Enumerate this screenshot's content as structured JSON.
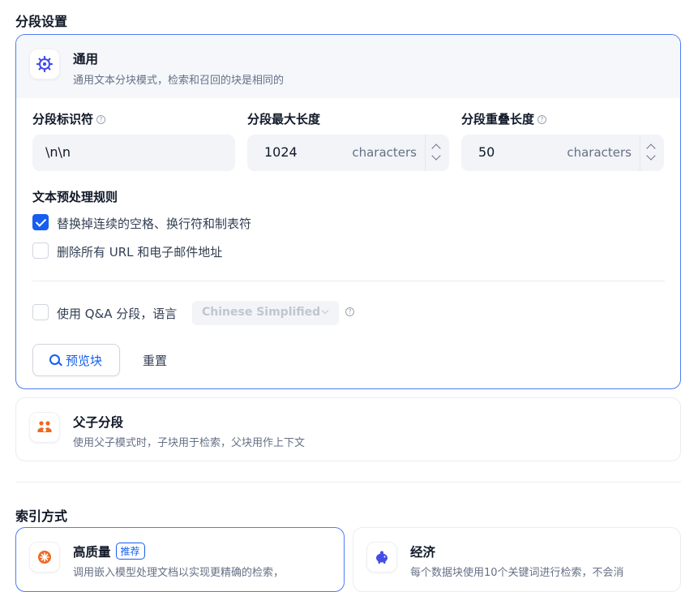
{
  "segment_settings": {
    "title": "分段设置",
    "general": {
      "title": "通用",
      "description": "通用文本分块模式，检索和召回的块是相同的",
      "delimiter": {
        "label": "分段标识符",
        "value": "\\n\\n"
      },
      "max_length": {
        "label": "分段最大长度",
        "value": "1024",
        "unit": "characters"
      },
      "overlap": {
        "label": "分段重叠长度",
        "value": "50",
        "unit": "characters"
      },
      "preprocess": {
        "title": "文本预处理规则",
        "rule_spaces": {
          "label": "替换掉连续的空格、换行符和制表符",
          "checked": true
        },
        "rule_urls": {
          "label": "删除所有 URL 和电子邮件地址",
          "checked": false
        }
      },
      "qa": {
        "label": "使用 Q&A 分段，语言",
        "language": "Chinese Simplified",
        "checked": false
      },
      "preview_button": "预览块",
      "reset_button": "重置"
    },
    "parent_child": {
      "title": "父子分段",
      "description": "使用父子模式时，子块用于检索，父块用作上下文"
    }
  },
  "index_mode": {
    "title": "索引方式",
    "high_quality": {
      "title": "高质量",
      "badge": "推荐",
      "description": "调用嵌入模型处理文档以实现更精确的检索，"
    },
    "economy": {
      "title": "经济",
      "description": "每个数据块使用10个关键词进行检索，不会消"
    }
  },
  "colors": {
    "accent": "#155eef",
    "border_active": "#4d7df2",
    "orange": "#ef6820",
    "purple": "#444ce7"
  }
}
